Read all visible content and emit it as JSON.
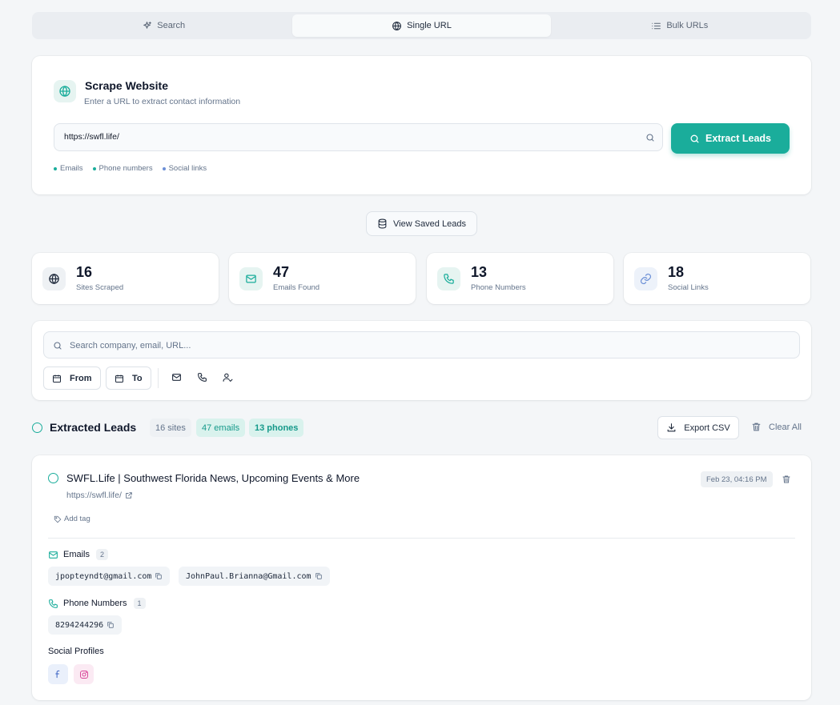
{
  "tabs": [
    {
      "label": "Search",
      "icon": "sparkle-icon"
    },
    {
      "label": "Single URL",
      "icon": "globe-icon",
      "active": true
    },
    {
      "label": "Bulk URLs",
      "icon": "list-icon"
    }
  ],
  "scrape": {
    "title": "Scrape Website",
    "subtitle": "Enter a URL to extract contact information",
    "url_value": "https://swfl.life/",
    "extract_label": "Extract Leads",
    "chips": [
      "Emails",
      "Phone numbers",
      "Social links"
    ],
    "chip_colors": [
      "#1aad9b",
      "#1aad9b",
      "#6b8fd6"
    ]
  },
  "saved": {
    "label": "View Saved Leads"
  },
  "stats": [
    {
      "value": "16",
      "label": "Sites Scraped"
    },
    {
      "value": "47",
      "label": "Emails Found"
    },
    {
      "value": "13",
      "label": "Phone Numbers"
    },
    {
      "value": "18",
      "label": "Social Links"
    }
  ],
  "filter": {
    "search_placeholder": "Search company, email, URL...",
    "from_label": "From",
    "to_label": "To"
  },
  "leads_header": {
    "title": "Extracted Leads",
    "sites_pill": "16 sites",
    "emails_pill": "47 emails",
    "phones_pill": "13 phones",
    "export_label": "Export CSV",
    "clear_label": "Clear All"
  },
  "lead": {
    "title": "SWFL.Life | Southwest Florida News, Upcoming Events & More",
    "url": "https://swfl.life/",
    "date": "Feb 23, 04:16 PM",
    "add_tag": "Add tag",
    "emails_label": "Emails",
    "emails_count": "2",
    "emails": [
      "jpopteyndt@gmail.com",
      "JohnPaul.Brianna@Gmail.com"
    ],
    "phones_label": "Phone Numbers",
    "phones_count": "1",
    "phones": [
      "8294244296"
    ],
    "social_label": "Social Profiles",
    "social": [
      "facebook-icon",
      "instagram-icon"
    ]
  },
  "colors": {
    "accent": "#1aad9b",
    "page_bg": "#f4f6f8"
  }
}
